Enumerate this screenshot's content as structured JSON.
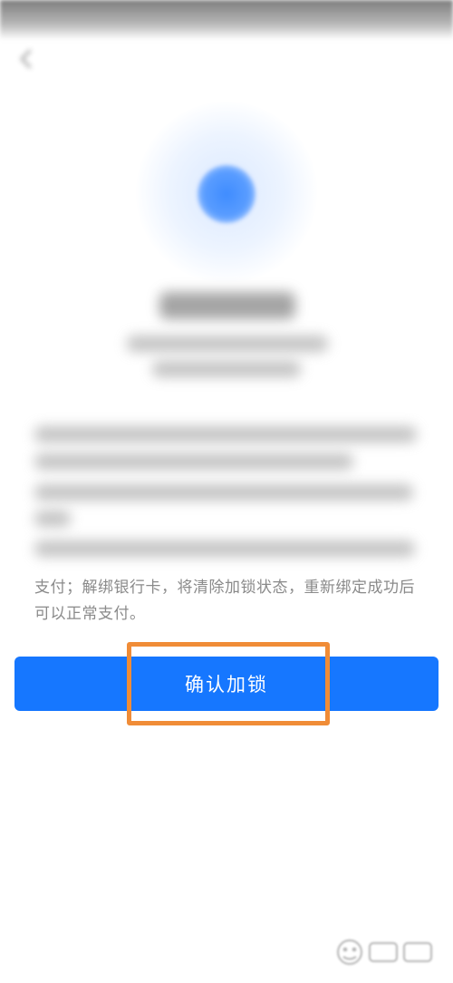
{
  "status_bar": {
    "color": "#7d7d7d"
  },
  "header": {
    "back_icon": "arrow-left-icon"
  },
  "hero": {
    "icon": "lock-icon",
    "accent_color": "#1677ff"
  },
  "content": {
    "partial_text_line_1": "支付；解绑银行卡，将清除加锁状态，重新绑定成功后",
    "partial_text_line_2": "可以正常支付。"
  },
  "actions": {
    "confirm_label": "确认加锁",
    "button_color": "#1677ff"
  },
  "annotation": {
    "highlight_color": "#f08c37"
  },
  "watermark": {
    "icon": "baidu-jingyan-watermark-icon"
  }
}
